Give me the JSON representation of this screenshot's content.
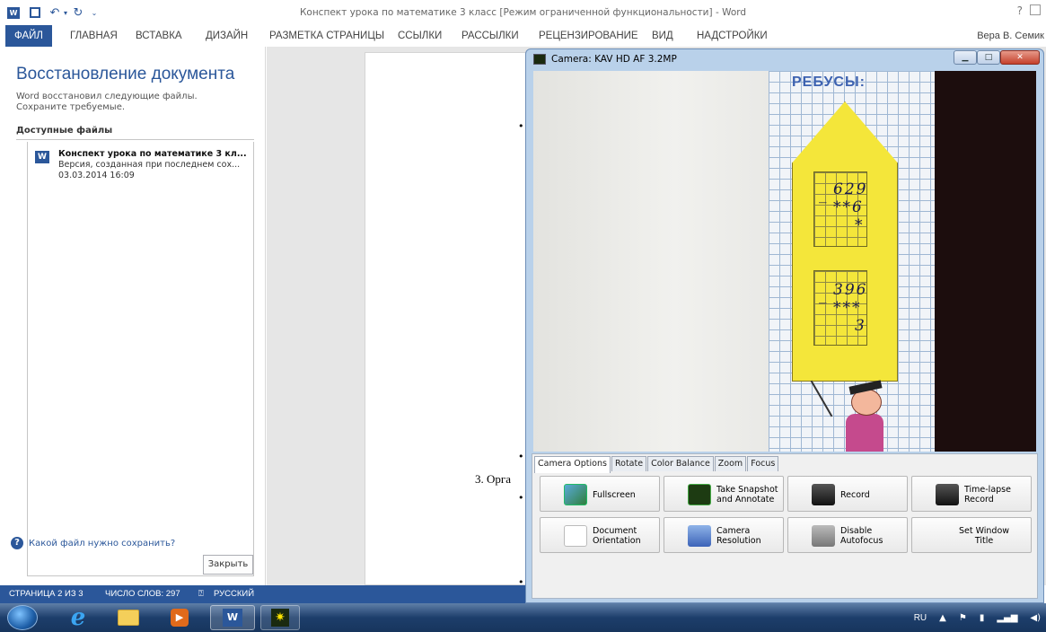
{
  "word": {
    "title": "Конспект урока по математике 3 класс [Режим ограниченной функциональности] - Word",
    "help": "?",
    "user": "Вера В. Семик",
    "tabs": [
      "ФАЙЛ",
      "ГЛАВНАЯ",
      "ВСТАВКА",
      "ДИЗАЙН",
      "РАЗМЕТКА СТРАНИЦЫ",
      "ССЫЛКИ",
      "РАССЫЛКИ",
      "РЕЦЕНЗИРОВАНИЕ",
      "ВИД",
      "НАДСТРОЙКИ"
    ]
  },
  "recovery": {
    "title": "Восстановление документа",
    "description": "Word восстановил следующие файлы. Сохраните требуемые.",
    "available": "Доступные файлы",
    "file": {
      "name": "Конспект урока по математике 3 кл...",
      "version": "Версия, созданная при последнем сох...",
      "date": "03.03.2014 16:09",
      "icon": "W"
    },
    "help_link": "Какой файл нужно сохранить?",
    "close": "Закрыть"
  },
  "document": {
    "visible_text": "3. Орга",
    "bullet": "•"
  },
  "status": {
    "page": "СТРАНИЦА 2 ИЗ 3",
    "words": "ЧИСЛО СЛОВ: 297",
    "lang": "РУССКИЙ"
  },
  "camera": {
    "title": "Camera: KAV HD AF 3.2MP",
    "image": {
      "header": "РЕБУСЫ:",
      "puzzle1": {
        "row1": "629",
        "row2": "**6",
        "row3": "*"
      },
      "puzzle2": {
        "row1": "396",
        "row2": "***",
        "row3": "3"
      },
      "minus": "_"
    },
    "tabs": [
      "Camera Options",
      "Rotate",
      "Color Balance",
      "Zoom",
      "Focus"
    ],
    "buttons": [
      {
        "label": "Fullscreen"
      },
      {
        "label": "Take Snapshot and Annotate"
      },
      {
        "label": "Record"
      },
      {
        "label": "Time-lapse Record"
      },
      {
        "label": "Document Orientation"
      },
      {
        "label": "Camera Resolution"
      },
      {
        "label": "Disable Autofocus"
      },
      {
        "label": "Set Window Title"
      }
    ]
  },
  "taskbar": {
    "lang": "RU",
    "ie": "e",
    "word": "W",
    "media": "▶"
  },
  "colors": {
    "word_blue": "#2b579a",
    "card_yellow": "#f4e63a",
    "rebus_blue": "#3d62b0"
  }
}
